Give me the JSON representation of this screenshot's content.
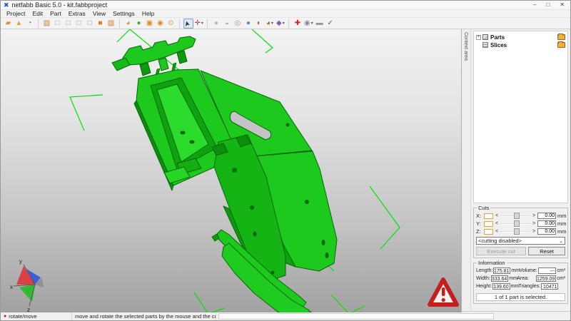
{
  "window": {
    "title": "netfabb Basic 5.0 - kit.fabbproject",
    "controls": {
      "minimize": "–",
      "maximize": "□",
      "close": "✕"
    },
    "logo_glyph": "✖"
  },
  "menu": {
    "items": [
      "Project",
      "Edit",
      "Part",
      "Extras",
      "View",
      "Settings",
      "Help"
    ]
  },
  "glyphs": {
    "dropdown": "▾",
    "expander": "+",
    "slider_left": "<",
    "slider_right": ">",
    "combo_chevron": "⌄",
    "status_dot": "●"
  },
  "toolbar": {
    "items": [
      {
        "name": "open-project",
        "glyph": "▰",
        "color": "#d8922c"
      },
      {
        "name": "repair-part",
        "glyph": "▲",
        "color": "#e8a52c"
      },
      {
        "name": "platform-view",
        "glyph": "◔",
        "color": "#4a7bd0"
      },
      {
        "sep": true
      },
      {
        "name": "view-isometric",
        "glyph": "▧",
        "color": "#c87f35"
      },
      {
        "name": "view-front",
        "glyph": "□",
        "color": "#8f949c"
      },
      {
        "name": "view-back",
        "glyph": "□",
        "color": "#8f949c"
      },
      {
        "name": "view-left",
        "glyph": "□",
        "color": "#8f949c"
      },
      {
        "name": "view-right",
        "glyph": "□",
        "color": "#8f949c"
      },
      {
        "name": "view-top",
        "glyph": "■",
        "color": "#e07f20"
      },
      {
        "name": "view-bottom",
        "glyph": "▨",
        "color": "#c87f35"
      },
      {
        "sep": true
      },
      {
        "name": "zoom-to-parts",
        "glyph": "◕",
        "color": "#e09030"
      },
      {
        "name": "zoom-to-selection",
        "glyph": "●",
        "color": "#3fae3f"
      },
      {
        "name": "zoom-box",
        "glyph": "▣",
        "color": "#e09030"
      },
      {
        "name": "zoom-window",
        "glyph": "◉",
        "color": "#d98a2b"
      },
      {
        "name": "zoom-in",
        "glyph": "⊙",
        "color": "#e8932c"
      },
      {
        "sep": true
      },
      {
        "name": "select-tool",
        "glyph": "➤",
        "color": "#333333",
        "active": true,
        "rot": true
      },
      {
        "name": "move-rotate-tool",
        "glyph": "✛",
        "color": "#c03030",
        "dropdown": true
      },
      {
        "sep": true
      },
      {
        "name": "shell-select",
        "glyph": "●",
        "color": "#b8b8b8"
      },
      {
        "name": "surface-select",
        "glyph": "◒",
        "color": "#a8a8a8"
      },
      {
        "name": "triangle-select",
        "glyph": "◎",
        "color": "#9a9a9a"
      },
      {
        "name": "mesh-view",
        "glyph": "●",
        "color": "#5c8ad0"
      },
      {
        "name": "highlight-errors",
        "glyph": "◐",
        "color": "#cc4433"
      },
      {
        "name": "shading-mode",
        "glyph": "◕",
        "color": "#a8682a",
        "dropdown": true
      },
      {
        "name": "measure-tool",
        "glyph": "◆",
        "color": "#8a5cae",
        "dropdown": true
      },
      {
        "sep": true
      },
      {
        "name": "add-part",
        "glyph": "✚",
        "color": "#d42222"
      },
      {
        "name": "repair-script",
        "glyph": "◉",
        "color": "#8a8a8a",
        "dropdown": true
      },
      {
        "name": "remove-part",
        "glyph": "▬",
        "color": "#9a9a9a"
      },
      {
        "name": "apply-repair",
        "glyph": "✓",
        "color": "#2a7a2a"
      }
    ]
  },
  "context_panel": {
    "tab_label": "Context area",
    "tree": {
      "items": [
        {
          "label": "Parts",
          "icon": "parts-icon",
          "expandable": true
        },
        {
          "label": "Slices",
          "icon": "slices-icon",
          "expandable": false
        }
      ]
    },
    "cuts": {
      "title": "Cuts",
      "axes": [
        {
          "label": "X:",
          "value": "0.00",
          "unit": "mm"
        },
        {
          "label": "Y:",
          "value": "0.00",
          "unit": "mm"
        },
        {
          "label": "Z:",
          "value": "0.00",
          "unit": "mm"
        }
      ],
      "mode_selected": "<cutting disabled>",
      "execute_label": "Execute cut",
      "reset_label": "Reset"
    },
    "information": {
      "title": "Information",
      "rows": [
        [
          {
            "label": "Length:",
            "value": "175.81",
            "unit": "mm"
          },
          {
            "label": "Volume:",
            "value": "---",
            "unit": "cm³"
          }
        ],
        [
          {
            "label": "Width:",
            "value": "333.64",
            "unit": "mm"
          },
          {
            "label": "Area:",
            "value": "1259.09",
            "unit": "cm²"
          }
        ],
        [
          {
            "label": "Height:",
            "value": "139.60",
            "unit": "mm"
          },
          {
            "label": "Triangles:",
            "value": "10471",
            "unit": ""
          }
        ]
      ],
      "selection_status": "1 of 1 part is selected."
    }
  },
  "viewport": {
    "axis_labels": {
      "x": "x",
      "y": "y",
      "z": "z"
    },
    "model_color": "#1ec91e",
    "marker_color": "#00e400",
    "warning_color": "#c41f1f"
  },
  "statusbar": {
    "mode": "rotate/move",
    "message": "move and rotate the selected parts by the mouse and the cursor keys"
  }
}
